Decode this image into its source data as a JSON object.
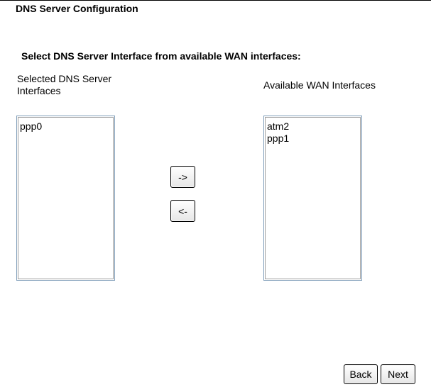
{
  "page": {
    "title": "DNS Server Configuration",
    "instruction": "Select DNS Server Interface from available WAN interfaces:"
  },
  "selected_list": {
    "label": "Selected DNS Server Interfaces",
    "items": [
      "ppp0"
    ]
  },
  "available_list": {
    "label": "Available WAN Interfaces",
    "items": [
      "atm2",
      "ppp1"
    ]
  },
  "buttons": {
    "add": "->",
    "remove": "<-",
    "back": "Back",
    "next": "Next"
  }
}
